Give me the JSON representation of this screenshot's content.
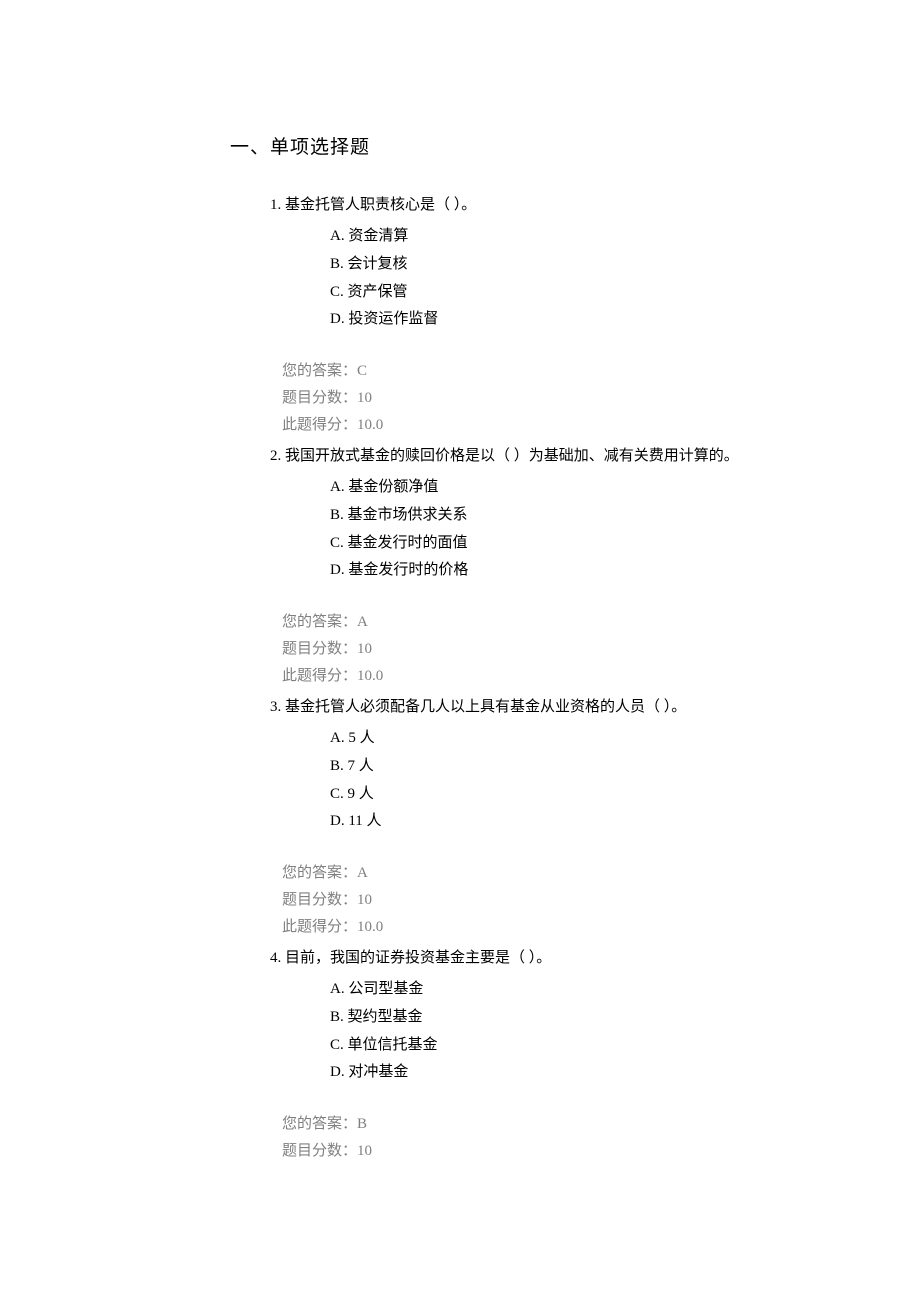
{
  "section_title": "一、单项选择题",
  "questions": [
    {
      "number": "1.",
      "text": "基金托管人职责核心是（ ）。",
      "options": [
        {
          "label": "A.",
          "text": "资金清算"
        },
        {
          "label": "B.",
          "text": "会计复核"
        },
        {
          "label": "C.",
          "text": "资产保管"
        },
        {
          "label": "D.",
          "text": "投资运作监督"
        }
      ],
      "answer_lines": [
        "您的答案：C",
        "题目分数：10",
        "此题得分：10.0"
      ]
    },
    {
      "number": "2.",
      "text": "我国开放式基金的赎回价格是以（ ）为基础加、减有关费用计算的。",
      "options": [
        {
          "label": "A.",
          "text": "基金份额净值"
        },
        {
          "label": "B.",
          "text": "基金市场供求关系"
        },
        {
          "label": "C.",
          "text": "基金发行时的面值"
        },
        {
          "label": "D.",
          "text": "基金发行时的价格"
        }
      ],
      "answer_lines": [
        "您的答案：A",
        "题目分数：10",
        "此题得分：10.0"
      ]
    },
    {
      "number": "3.",
      "text": "基金托管人必须配备几人以上具有基金从业资格的人员（ ）。",
      "options": [
        {
          "label": "A.",
          "text": "5 人"
        },
        {
          "label": "B.",
          "text": "7 人"
        },
        {
          "label": "C.",
          "text": "9 人"
        },
        {
          "label": "D.",
          "text": "11 人"
        }
      ],
      "answer_lines": [
        "您的答案：A",
        "题目分数：10",
        "此题得分：10.0"
      ]
    },
    {
      "number": "4.",
      "text": "目前，我国的证券投资基金主要是（ ）。",
      "options": [
        {
          "label": "A.",
          "text": "公司型基金"
        },
        {
          "label": "B.",
          "text": "契约型基金"
        },
        {
          "label": "C.",
          "text": "单位信托基金"
        },
        {
          "label": "D.",
          "text": "对冲基金"
        }
      ],
      "answer_lines": [
        "您的答案：B",
        "题目分数：10"
      ]
    }
  ]
}
